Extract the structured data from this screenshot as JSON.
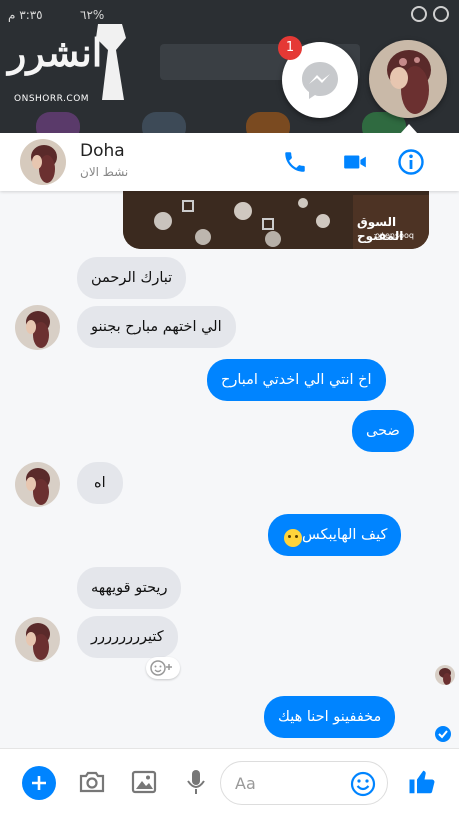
{
  "status_bar": {
    "time": "٣:٣٥ م",
    "battery": "٦٢%"
  },
  "watermark": {
    "logo_text": "انشرر",
    "site": "ONSHORR.COM"
  },
  "chat_head": {
    "badge_count": "1"
  },
  "header": {
    "name": "Doha",
    "status": "نشط الان"
  },
  "shared_image": {
    "brand": "السوق المفتوح",
    "domain": "opensooq"
  },
  "messages": [
    {
      "from": "them",
      "text": "تبارك الرحمن"
    },
    {
      "from": "them",
      "text": "الي اختهم مبارح بجننو"
    },
    {
      "from": "me",
      "text": "اخ انتي الي اخدتي امبارح"
    },
    {
      "from": "me",
      "text": "ضحى"
    },
    {
      "from": "them",
      "text": "اه"
    },
    {
      "from": "me",
      "text": "كيف الهايبكس",
      "emoji": "😶"
    },
    {
      "from": "them",
      "text": "ريحتو قويههه"
    },
    {
      "from": "them",
      "text": "كتيرررررررر"
    },
    {
      "from": "me",
      "text": "مخففينو احنا هيك"
    }
  ],
  "composer": {
    "placeholder": "Aa"
  },
  "colors": {
    "accent": "#0084ff",
    "incoming_bubble": "#e4e6eb",
    "badge": "#e53935"
  }
}
